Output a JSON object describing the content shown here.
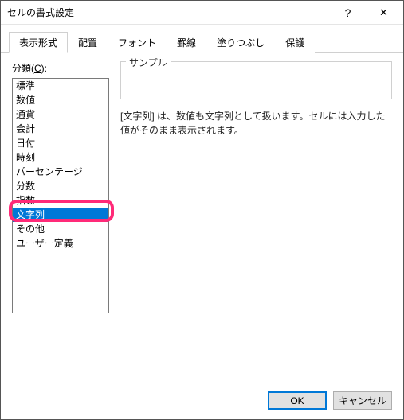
{
  "window": {
    "title": "セルの書式設定",
    "help_icon": "?",
    "close_icon": "✕"
  },
  "tabs": {
    "items": [
      {
        "label": "表示形式",
        "active": true
      },
      {
        "label": "配置",
        "active": false
      },
      {
        "label": "フォント",
        "active": false
      },
      {
        "label": "罫線",
        "active": false
      },
      {
        "label": "塗りつぶし",
        "active": false
      },
      {
        "label": "保護",
        "active": false
      }
    ]
  },
  "category": {
    "label_prefix": "分類(",
    "label_key": "C",
    "label_suffix": "):",
    "items": [
      "標準",
      "数値",
      "通貨",
      "会計",
      "日付",
      "時刻",
      "パーセンテージ",
      "分数",
      "指数",
      "文字列",
      "その他",
      "ユーザー定義"
    ],
    "selected_index": 9
  },
  "sample": {
    "label": "サンプル",
    "value": ""
  },
  "description": "[文字列] は、数値も文字列として扱います。セルには入力した値がそのまま表示されます。",
  "buttons": {
    "ok": "OK",
    "cancel": "キャンセル"
  }
}
